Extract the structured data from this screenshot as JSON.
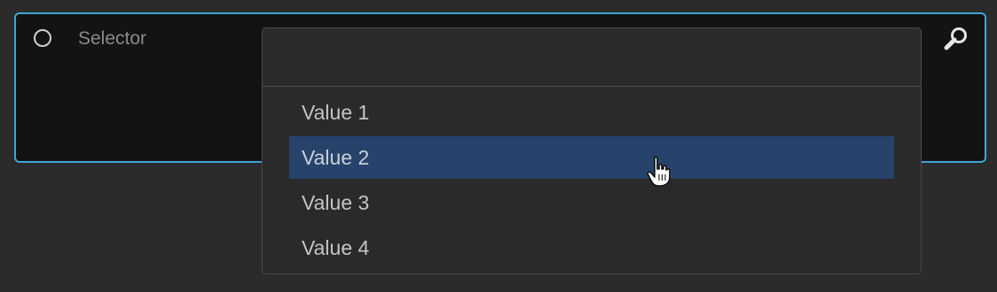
{
  "selector": {
    "label": "Selector"
  },
  "dropdown": {
    "value": "",
    "options": [
      {
        "label": "Value 1",
        "selected": false
      },
      {
        "label": "Value 2",
        "selected": true
      },
      {
        "label": "Value 3",
        "selected": false
      },
      {
        "label": "Value 4",
        "selected": false
      }
    ]
  },
  "colors": {
    "accent_border": "#3ea6d6",
    "selected_bg": "#27436b"
  },
  "icons": {
    "search": "search-icon",
    "radio": "radio-icon",
    "cursor": "hand-cursor-icon"
  }
}
